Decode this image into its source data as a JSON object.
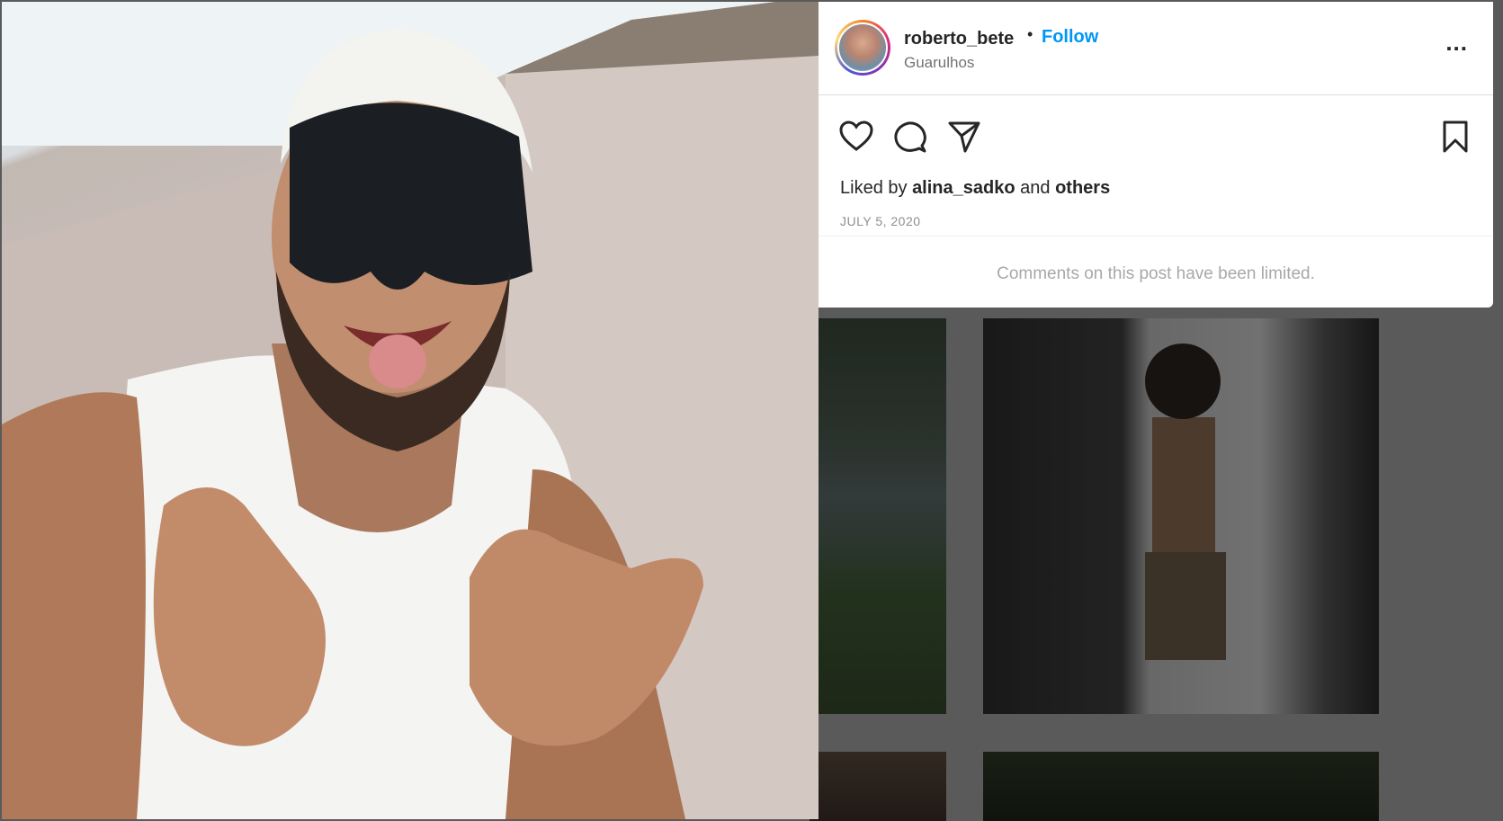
{
  "post": {
    "username": "roberto_bete",
    "separator": "•",
    "follow_label": "Follow",
    "location": "Guarulhos",
    "more_label": "...",
    "liked_prefix": "Liked by",
    "liked_user": "alina_sadko",
    "liked_and": "and",
    "liked_others": "others",
    "date": "JULY 5, 2020",
    "comments_notice": "Comments on this post have been limited."
  },
  "icons": {
    "like": "heart-icon",
    "comment": "comment-bubble-icon",
    "share": "paper-plane-icon",
    "save": "bookmark-icon",
    "more": "ellipsis-icon"
  },
  "colors": {
    "follow": "#0095f6",
    "text": "#262626",
    "muted": "#737373",
    "overlay": "#5a5a5a"
  }
}
